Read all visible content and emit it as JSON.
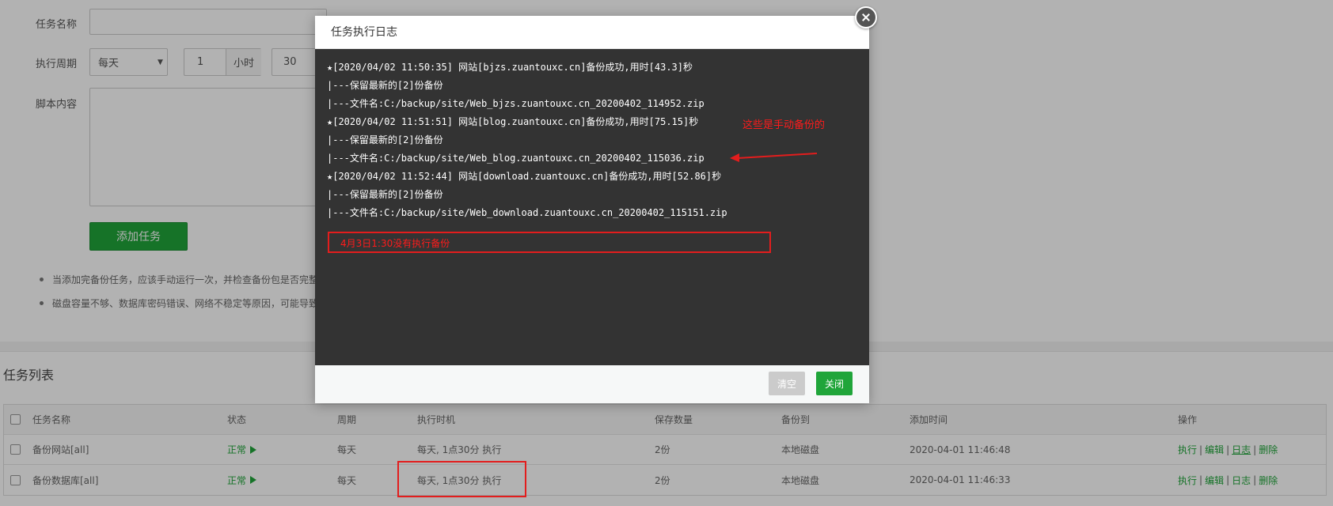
{
  "form": {
    "task_name_label": "任务名称",
    "period_label": "执行周期",
    "period_select": "每天",
    "hours_value": "1",
    "hours_unit": "小时",
    "minutes_value": "30",
    "script_label": "脚本内容",
    "add_button": "添加任务",
    "tips": [
      "当添加完备份任务，应该手动运行一次，并检查备份包是否完整",
      "磁盘容量不够、数据库密码错误、网络不稳定等原因，可能导致"
    ]
  },
  "task_list": {
    "title": "任务列表",
    "columns": [
      "任务名称",
      "状态",
      "周期",
      "执行时机",
      "保存数量",
      "备份到",
      "添加时间",
      "操作"
    ],
    "rows": [
      {
        "name": "备份网站[all]",
        "status": "正常",
        "period": "每天",
        "timing": "每天, 1点30分 执行",
        "keep": "2份",
        "target": "本地磁盘",
        "added": "2020-04-01 11:46:48"
      },
      {
        "name": "备份数据库[all]",
        "status": "正常",
        "period": "每天",
        "timing": "每天, 1点30分 执行",
        "keep": "2份",
        "target": "本地磁盘",
        "added": "2020-04-01 11:46:33"
      }
    ],
    "actions": {
      "run": "执行",
      "edit": "编辑",
      "log": "日志",
      "delete": "删除",
      "sep": "|"
    }
  },
  "modal": {
    "title": "任务执行日志",
    "log_lines": [
      "★[2020/04/02 11:50:35] 网站[bjzs.zuantouxc.cn]备份成功,用时[43.3]秒",
      "|---保留最新的[2]份备份",
      "|---文件名:C:/backup/site/Web_bjzs.zuantouxc.cn_20200402_114952.zip",
      "★[2020/04/02 11:51:51] 网站[blog.zuantouxc.cn]备份成功,用时[75.15]秒",
      "|---保留最新的[2]份备份",
      "|---文件名:C:/backup/site/Web_blog.zuantouxc.cn_20200402_115036.zip",
      "★[2020/04/02 11:52:44] 网站[download.zuantouxc.cn]备份成功,用时[52.86]秒",
      "|---保留最新的[2]份备份",
      "|---文件名:C:/backup/site/Web_download.zuantouxc.cn_20200402_115151.zip"
    ],
    "clear_button": "清空",
    "close_button": "关闭"
  },
  "annotations": {
    "manual_note": "这些是手动备份的",
    "missed_note": "4月3日1:30没有执行备份",
    "color": "#ff1b1b"
  },
  "colors": {
    "accent": "#20a53a",
    "log_bg": "#333333"
  }
}
